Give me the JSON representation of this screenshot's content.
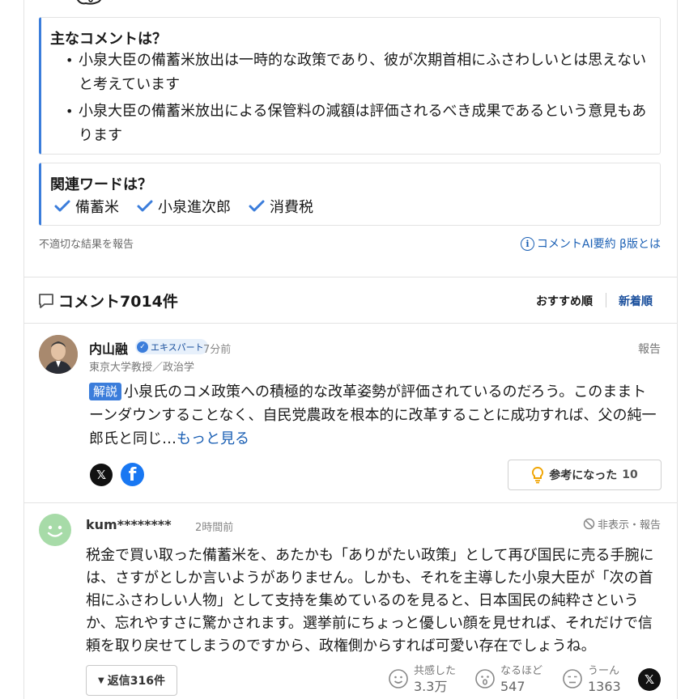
{
  "summary": {
    "main_title": "主なコメントは？",
    "main_points": [
      "小泉大臣の備蓄米放出は一時的な政策であり、彼が次期首相にふさわしいとは思えないと考えています",
      "小泉大臣の備蓄米放出による保管料の減額は評価されるべき成果であるという意見もあります"
    ],
    "words_title": "関連ワードは？",
    "words": [
      "備蓄米",
      "小泉進次郎",
      "消費税"
    ],
    "report_link": "不適切な結果を報告",
    "ai_link": "コメントAI要約 β版とは"
  },
  "comments_header": {
    "title": "コメント7014件",
    "sort_recommended": "おすすめ順",
    "sort_newest": "新着順"
  },
  "expert_comment": {
    "name": "内山融",
    "badge": "エキスパート",
    "time": "7分前",
    "report": "報告",
    "title": "東京大学教授／政治学",
    "tag": "解説",
    "body": "小泉氏のコメ政策への積極的な改革姿勢が評価されているのだろう。このままトーンダウンすることなく、自民党農政を根本的に改革することに成功すれば、父の純一郎氏と同じ…",
    "more": "もっと見る",
    "helpful_label": "参考になった",
    "helpful_count": "10"
  },
  "user_comment": {
    "name": "kum********",
    "time": "2時間前",
    "hide_report": "非表示・報告",
    "body": "税金で買い取った備蓄米を、あたかも「ありがたい政策」として再び国民に売る手腕には、さすがとしか言いようがありません。しかも、それを主導した小泉大臣が「次の首相にふさわしい人物」として支持を集めているのを見ると、日本国民の純粋さというか、忘れやすさに驚かされます。選挙前にちょっと優しい顔を見せれば、それだけで信頼を取り戻せてしまうのですから、政権側からすれば可愛い存在でしょうね。",
    "reply_label": "返信316件",
    "reactions": [
      {
        "label": "共感した",
        "count": "3.3万"
      },
      {
        "label": "なるほど",
        "count": "547"
      },
      {
        "label": "うーん",
        "count": "1363"
      }
    ]
  },
  "colors": {
    "accent": "#3b7ddb",
    "link": "#1a5fb4",
    "facebook": "#1877f2"
  },
  "icons": [
    "robot-icon",
    "check-icon",
    "info-icon",
    "comment-bubble-icon",
    "verified-icon",
    "x-icon",
    "facebook-icon",
    "lightbulb-icon",
    "smile-avatar-icon",
    "block-icon",
    "smile-reaction-icon",
    "surprise-reaction-icon",
    "hmm-reaction-icon"
  ]
}
